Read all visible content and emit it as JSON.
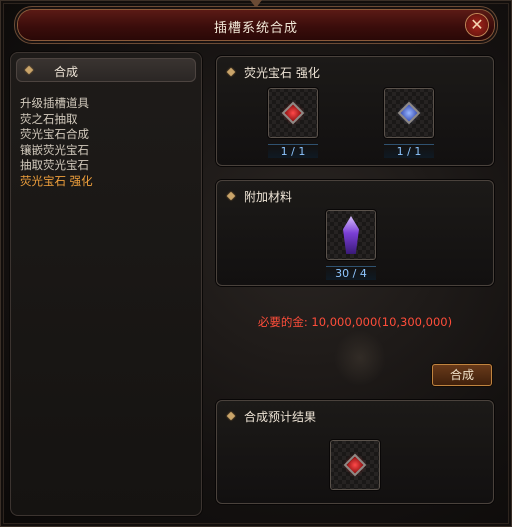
{
  "window": {
    "title": "插槽系统合成",
    "close_icon": "✕"
  },
  "sidebar": {
    "header": "合成",
    "items": [
      {
        "label": "升级插槽道具"
      },
      {
        "label": "荧之石抽取"
      },
      {
        "label": "荧光宝石合成"
      },
      {
        "label": "镶嵌荧光宝石"
      },
      {
        "label": "抽取荧光宝石"
      },
      {
        "label": "荧光宝石 强化",
        "active": true
      }
    ]
  },
  "main": {
    "enhance": {
      "title": "荧光宝石 强化",
      "slots": [
        {
          "icon": "red-gem-icon",
          "count": "1 / 1"
        },
        {
          "icon": "blue-gem-icon",
          "count": "1 / 1"
        }
      ]
    },
    "material": {
      "title": "附加材料",
      "slot": {
        "icon": "purple-crystal-icon",
        "count": "30 / 4"
      }
    },
    "cost": "必要的金: 10,000,000(10,300,000)",
    "craft_button": "合成",
    "result": {
      "title": "合成预计结果",
      "slot": {
        "icon": "red-gem-icon"
      }
    }
  },
  "colors": {
    "active_menu": "#f0a03c",
    "cost_text": "#ff4d3a",
    "count_text": "#8ec6ff",
    "title_bar": "#5b1a15"
  }
}
